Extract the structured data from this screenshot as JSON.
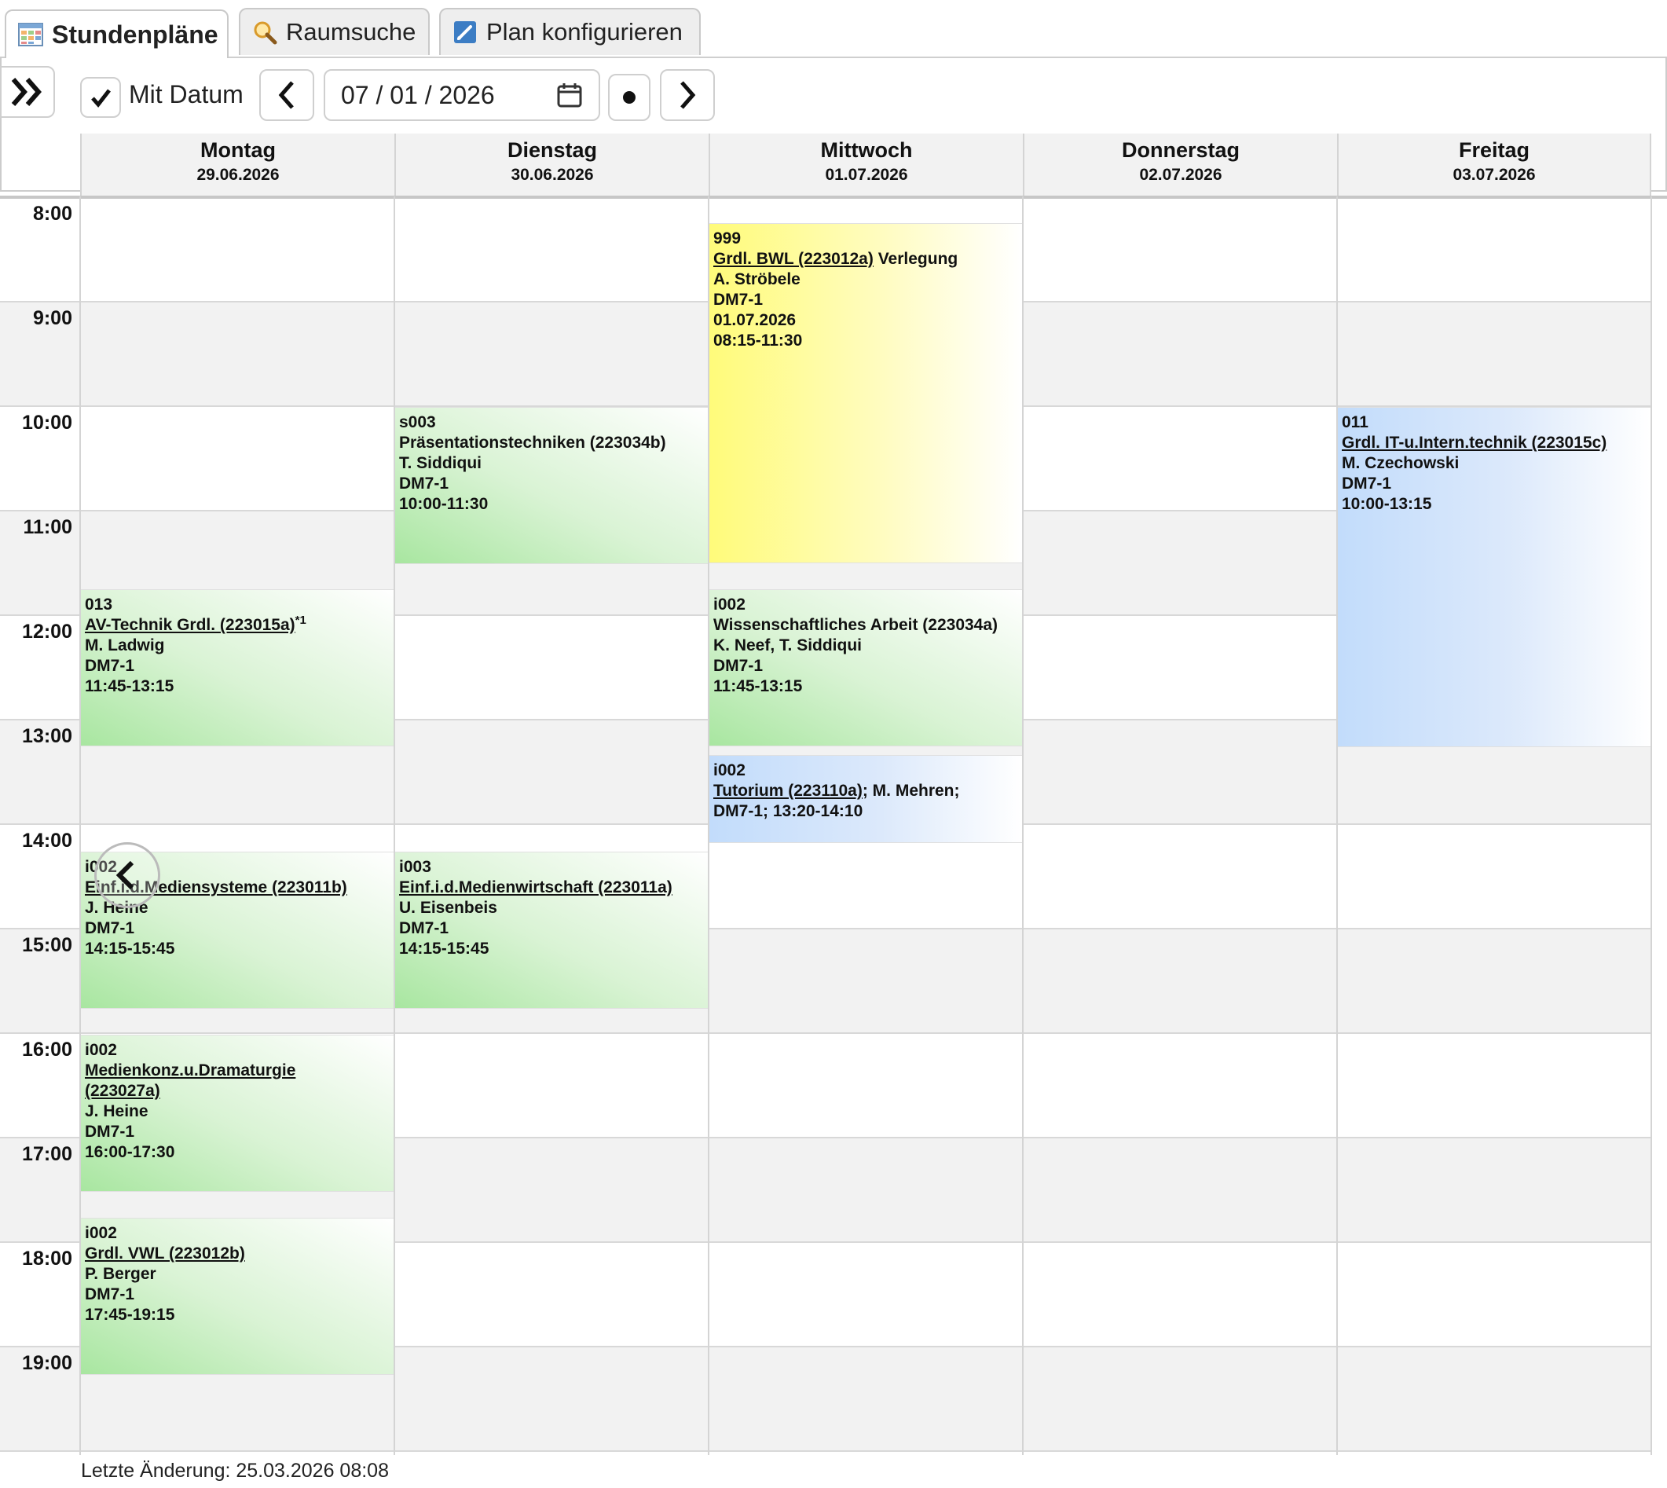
{
  "tabs": [
    {
      "label": "Stundenpläne",
      "icon": "calendar-table-icon"
    },
    {
      "label": "Raumsuche",
      "icon": "magnifier-icon"
    },
    {
      "label": "Plan konfigurieren",
      "icon": "edit-pencil-icon"
    }
  ],
  "toolbar": {
    "expand_icon": "double-chevron-right-icon",
    "with_date_label": "Mit Datum",
    "with_date_checked": true,
    "prev_icon": "chevron-left-icon",
    "date_value": "07 / 01 / 2026",
    "calendar_icon": "calendar-icon",
    "today_icon": "dot-icon",
    "next_icon": "chevron-right-icon"
  },
  "days": [
    {
      "name": "Montag",
      "date": "29.06.2026"
    },
    {
      "name": "Dienstag",
      "date": "30.06.2026"
    },
    {
      "name": "Mittwoch",
      "date": "01.07.2026"
    },
    {
      "name": "Donnerstag",
      "date": "02.07.2026"
    },
    {
      "name": "Freitag",
      "date": "03.07.2026"
    }
  ],
  "hours": [
    "8:00",
    "9:00",
    "10:00",
    "11:00",
    "12:00",
    "13:00",
    "14:00",
    "15:00",
    "16:00",
    "17:00",
    "18:00",
    "19:00"
  ],
  "events": {
    "mo_av": {
      "room": "013",
      "course": "AV-Technik Grdl. (223015a)",
      "note": "*1",
      "lecturer": "M. Ladwig",
      "group": "DM7-1",
      "time": "11:45-13:15"
    },
    "mo_med": {
      "room": "i002",
      "course": "Einf.i.d.Mediensysteme (223011b)",
      "lecturer": "J. Heine",
      "group": "DM7-1",
      "time": "14:15-15:45"
    },
    "mo_dram": {
      "room": "i002",
      "course_a": "Medienkonz.u.Dramaturgie",
      "course_b": "(223027a)",
      "lecturer": "J. Heine",
      "group": "DM7-1",
      "time": "16:00-17:30"
    },
    "mo_vwl": {
      "room": "i002",
      "course": "Grdl. VWL (223012b)",
      "lecturer": "P. Berger",
      "group": "DM7-1",
      "time": "17:45-19:15"
    },
    "di_praes": {
      "room": "s003",
      "course": "Präsentationstechniken (223034b)",
      "lecturer": "T. Siddiqui",
      "group": "DM7-1",
      "time": "10:00-11:30"
    },
    "di_mw": {
      "room": "i003",
      "course": "Einf.i.d.Medienwirtschaft (223011a)",
      "lecturer": "U. Eisenbeis",
      "group": "DM7-1",
      "time": "14:15-15:45"
    },
    "mi_bwl": {
      "room": "999",
      "course": "Grdl. BWL (223012a)",
      "status": " Verlegung",
      "lecturer": "A. Ströbele",
      "group": "DM7-1",
      "date": "01.07.2026",
      "time": "08:15-11:30"
    },
    "mi_wiss": {
      "room": "i002",
      "course": "Wissenschaftliches Arbeit (223034a)",
      "lecturer": "K. Neef, T. Siddiqui",
      "group": "DM7-1",
      "time": "11:45-13:15"
    },
    "mi_tut": {
      "room": "i002",
      "course": "Tutorium (223110a)",
      "rest": "; M. Mehren;",
      "line3": "DM7-1; 13:20-14:10"
    },
    "fr_it": {
      "room": "011",
      "course": "Grdl. IT-u.Intern.technik (223015c)",
      "lecturer": "M. Czechowski",
      "group": "DM7-1",
      "time": "10:00-13:15"
    }
  },
  "footer": {
    "last_change": "Letzte Änderung: 25.03.2026 08:08"
  },
  "floating": {
    "back_icon": "chevron-left-icon"
  },
  "colors": {
    "green": "#a8e6a0",
    "yellow": "#fffb7a",
    "blue": "#c2dcfb",
    "alt_row": "#f2f2f2"
  }
}
